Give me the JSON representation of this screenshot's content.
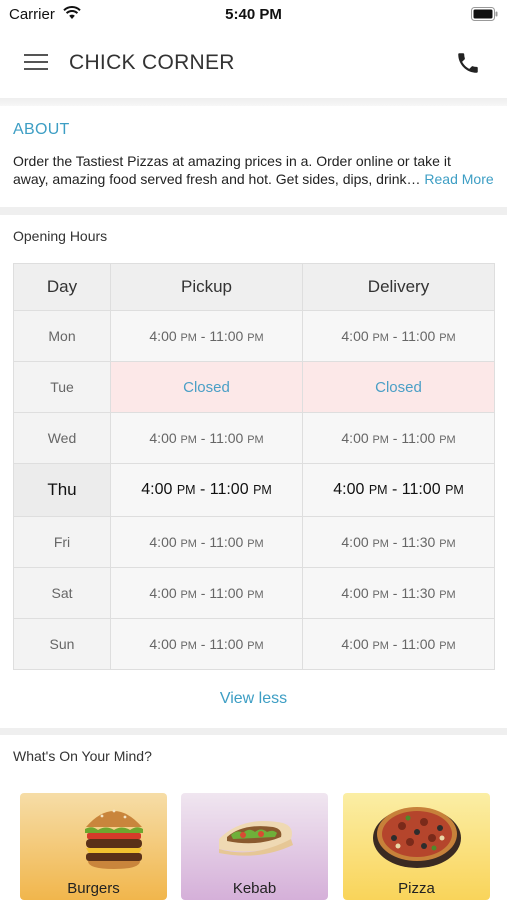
{
  "status_bar": {
    "carrier": "Carrier",
    "time": "5:40 PM"
  },
  "nav": {
    "title": "CHICK CORNER"
  },
  "about": {
    "title": "ABOUT",
    "line1": "Order the Tastiest Pizzas at amazing prices in a. Order online or take it",
    "line2": "away, amazing food served fresh and hot. Get sides, dips, drink…",
    "read_more": "Read More"
  },
  "opening_hours": {
    "label": "Opening Hours",
    "columns": [
      "Day",
      "Pickup",
      "Delivery"
    ],
    "rows": [
      {
        "day": "Mon",
        "pickup_open": "4:00",
        "pickup_open_ampm": "PM",
        "pickup_close": "11:00",
        "pickup_close_ampm": "PM",
        "delivery_open": "4:00",
        "delivery_open_ampm": "PM",
        "delivery_close": "11:00",
        "delivery_close_ampm": "PM"
      },
      {
        "day": "Tue",
        "pickup": "Closed",
        "delivery": "Closed"
      },
      {
        "day": "Wed",
        "pickup_open": "4:00",
        "pickup_open_ampm": "PM",
        "pickup_close": "11:00",
        "pickup_close_ampm": "PM",
        "delivery_open": "4:00",
        "delivery_open_ampm": "PM",
        "delivery_close": "11:00",
        "delivery_close_ampm": "PM"
      },
      {
        "day": "Thu",
        "pickup_open": "4:00",
        "pickup_open_ampm": "PM",
        "pickup_close": "11:00",
        "pickup_close_ampm": "PM",
        "delivery_open": "4:00",
        "delivery_open_ampm": "PM",
        "delivery_close": "11:00",
        "delivery_close_ampm": "PM"
      },
      {
        "day": "Fri",
        "pickup_open": "4:00",
        "pickup_open_ampm": "PM",
        "pickup_close": "11:00",
        "pickup_close_ampm": "PM",
        "delivery_open": "4:00",
        "delivery_open_ampm": "PM",
        "delivery_close": "11:30",
        "delivery_close_ampm": "PM"
      },
      {
        "day": "Sat",
        "pickup_open": "4:00",
        "pickup_open_ampm": "PM",
        "pickup_close": "11:00",
        "pickup_close_ampm": "PM",
        "delivery_open": "4:00",
        "delivery_open_ampm": "PM",
        "delivery_close": "11:30",
        "delivery_close_ampm": "PM"
      },
      {
        "day": "Sun",
        "pickup_open": "4:00",
        "pickup_open_ampm": "PM",
        "pickup_close": "11:00",
        "pickup_close_ampm": "PM",
        "delivery_open": "4:00",
        "delivery_open_ampm": "PM",
        "delivery_close": "11:00",
        "delivery_close_ampm": "PM"
      }
    ],
    "view_less": "View less"
  },
  "mind": {
    "label": "What's On Your Mind?",
    "categories": [
      {
        "label": "Burgers",
        "icon": "burger-icon"
      },
      {
        "label": "Kebab",
        "icon": "kebab-icon"
      },
      {
        "label": "Pizza",
        "icon": "pizza-icon"
      }
    ]
  },
  "colors": {
    "accent": "#3d9ec4",
    "closed_bg": "#fce8e8"
  }
}
